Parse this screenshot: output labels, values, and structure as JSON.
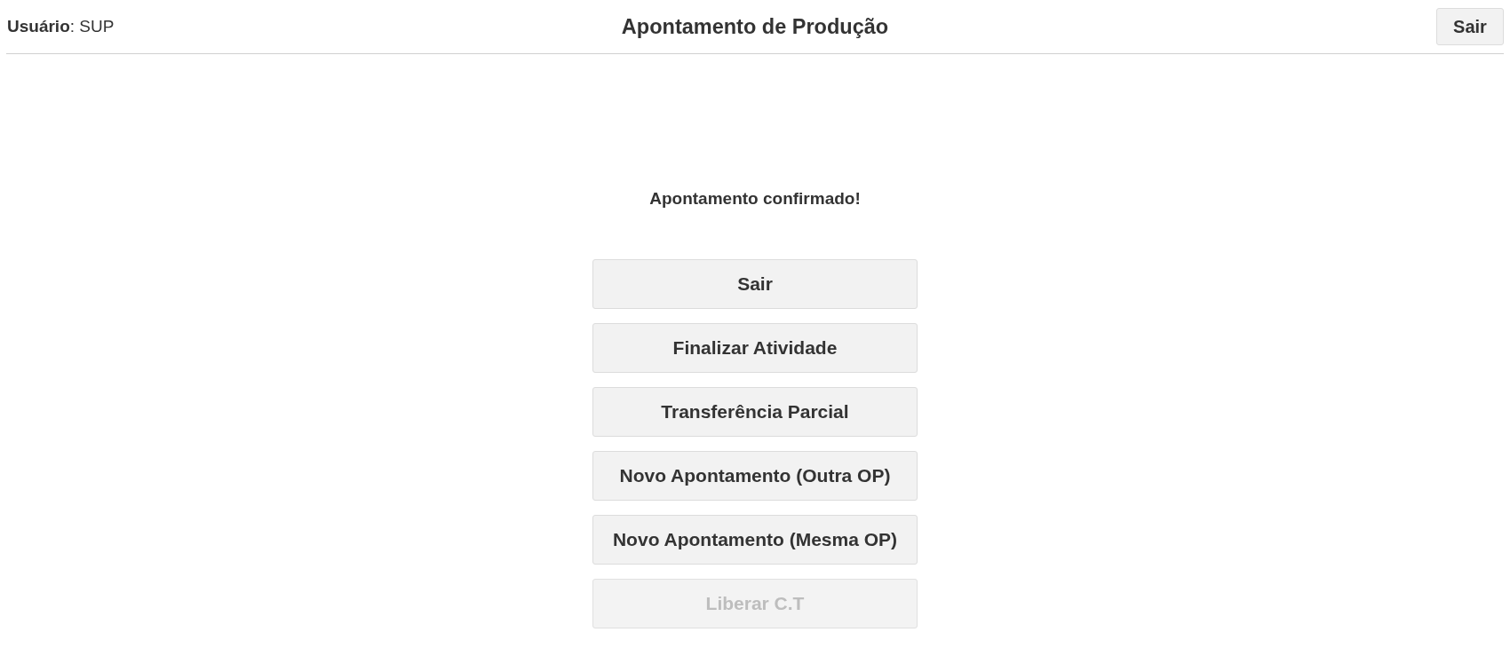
{
  "header": {
    "user": "**Usuário**: SUP",
    "title": "Apontamento de Produção",
    "exit_button": "Sair"
  },
  "message": "Apontamento confirmado!",
  "actions": [
    {
      "label": "Sair",
      "disabled": false
    },
    {
      "label": "Finalizar Atividade",
      "disabled": false
    },
    {
      "label": "Transferência Parcial",
      "disabled": false
    },
    {
      "label": "Novo Apontamento (Outra OP)",
      "disabled": false
    },
    {
      "label": "Novo Apontamento (Mesma OP)",
      "disabled": false
    },
    {
      "label": "Liberar C.T",
      "disabled": true
    }
  ]
}
